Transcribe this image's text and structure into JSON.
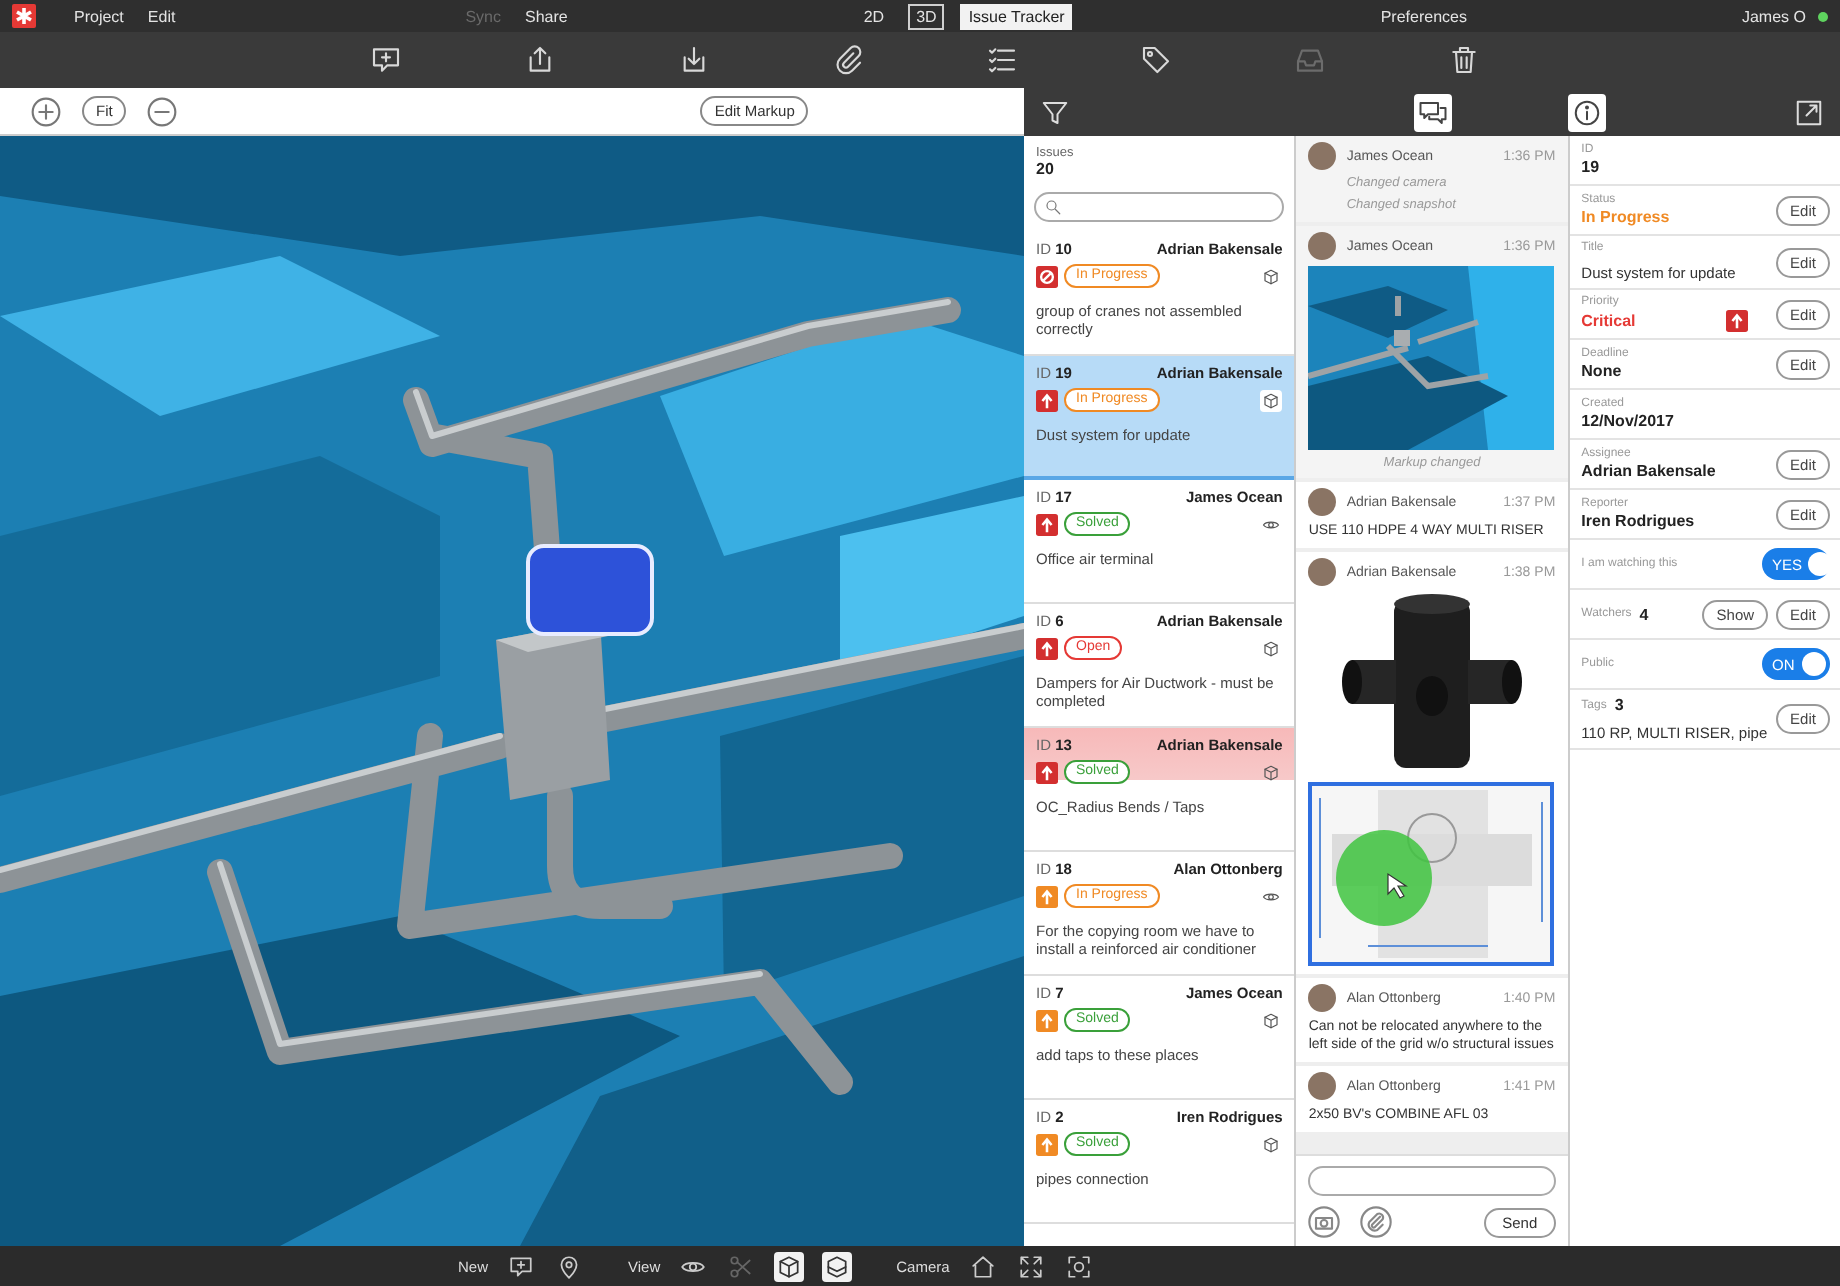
{
  "menu": {
    "items": [
      {
        "label": "Project",
        "disabled": false
      },
      {
        "label": "Edit",
        "disabled": false
      },
      {
        "label": "Sync",
        "disabled": true
      },
      {
        "label": "Share",
        "disabled": false
      }
    ],
    "modes": [
      {
        "label": "2D",
        "kind": "view",
        "selected": false
      },
      {
        "label": "3D",
        "kind": "view",
        "selected": true
      },
      {
        "label": "Issue Tracker",
        "kind": "panel",
        "selected": true
      }
    ],
    "preferences": "Preferences",
    "user": {
      "name": "James O",
      "online": true
    }
  },
  "toolbar": [
    {
      "kind": "comment",
      "disabled": false
    },
    {
      "kind": "upload",
      "disabled": false
    },
    {
      "kind": "download",
      "disabled": false
    },
    {
      "kind": "paperclip",
      "disabled": false
    },
    {
      "kind": "checklist",
      "disabled": false
    },
    {
      "kind": "tag",
      "disabled": false
    },
    {
      "kind": "inbox",
      "disabled": true
    },
    {
      "kind": "trash",
      "disabled": false
    }
  ],
  "viewer": {
    "fit": "Fit",
    "edit_markup": "Edit Markup"
  },
  "panel_tabs": [
    {
      "kind": "filter",
      "selected": false
    },
    {
      "kind": "comments",
      "selected": true
    },
    {
      "kind": "info",
      "selected": true
    },
    {
      "kind": "detach",
      "selected": false
    }
  ],
  "issues": {
    "label": "Issues",
    "count": "20",
    "items": [
      {
        "id_label": "ID",
        "id": "10",
        "author": "Adrian Bakensale",
        "priority": {
          "color": "#d32f2f",
          "blocked": true
        },
        "status": "In Progress",
        "color": "#f08a24",
        "kind": "cube",
        "description": "group of cranes not assembled correctly",
        "selected": false,
        "highlighted": false
      },
      {
        "id_label": "ID",
        "id": "19",
        "author": "Adrian Bakensale",
        "priority": {
          "color": "#d32f2f",
          "blocked": false
        },
        "status": "In Progress",
        "color": "#f08a24",
        "kind": "cube",
        "description": "Dust system for update",
        "selected": true,
        "highlighted": false
      },
      {
        "id_label": "ID",
        "id": "17",
        "author": "James Ocean",
        "priority": {
          "color": "#d32f2f",
          "blocked": false
        },
        "status": "Solved",
        "color": "#3aa03a",
        "kind": "eye",
        "description": "Office air terminal",
        "selected": false,
        "highlighted": false
      },
      {
        "id_label": "ID",
        "id": "6",
        "author": "Adrian Bakensale",
        "priority": {
          "color": "#d32f2f",
          "blocked": false
        },
        "status": "Open",
        "color": "#e53935",
        "kind": "cube",
        "description": "Dampers for Air Ductwork - must be completed",
        "selected": false,
        "highlighted": false
      },
      {
        "id_label": "ID",
        "id": "13",
        "author": "Adrian Bakensale",
        "priority": {
          "color": "#d32f2f",
          "blocked": false
        },
        "status": "Solved",
        "color": "#3aa03a",
        "kind": "cube",
        "description": "OC_Radius Bends / Taps",
        "selected": false,
        "highlighted": true
      },
      {
        "id_label": "ID",
        "id": "18",
        "author": "Alan Ottonberg",
        "priority": {
          "color": "#f08a24",
          "blocked": false
        },
        "status": "In Progress",
        "color": "#f08a24",
        "kind": "eye",
        "description": "For the copying room we have to install a reinforced air conditioner",
        "selected": false,
        "highlighted": false
      },
      {
        "id_label": "ID",
        "id": "7",
        "author": "James Ocean",
        "priority": {
          "color": "#f08a24",
          "blocked": false
        },
        "status": "Solved",
        "color": "#3aa03a",
        "kind": "cube",
        "description": "add taps to these places",
        "selected": false,
        "highlighted": false
      },
      {
        "id_label": "ID",
        "id": "2",
        "author": "Iren Rodrigues",
        "priority": {
          "color": "#f08a24",
          "blocked": false
        },
        "status": "Solved",
        "color": "#3aa03a",
        "kind": "cube",
        "description": "pipes connection",
        "selected": false,
        "highlighted": false
      }
    ]
  },
  "comments": {
    "items": [
      {
        "kind": "event",
        "author": "James Ocean",
        "time": "1:36 PM",
        "lines": [
          "Changed camera",
          "Changed snapshot"
        ]
      },
      {
        "kind": "snapshot",
        "author": "James Ocean",
        "time": "1:36 PM",
        "caption": "Markup changed"
      },
      {
        "kind": "text",
        "author": "Adrian Bakensale",
        "time": "1:37 PM",
        "text": "USE 110 HDPE 4 WAY MULTI RISER"
      },
      {
        "kind": "images",
        "author": "Adrian Bakensale",
        "time": "1:38 PM"
      },
      {
        "kind": "text",
        "author": "Alan Ottonberg",
        "time": "1:40 PM",
        "text": "Can not be relocated anywhere to the left side of the grid w/o structural issues"
      },
      {
        "kind": "text",
        "author": "Alan Ottonberg",
        "time": "1:41 PM",
        "text": "2x50 BV's COMBINE AFL 03"
      }
    ],
    "send": "Send"
  },
  "details": [
    {
      "kind": "text",
      "label": "ID",
      "value": "19"
    },
    {
      "kind": "text",
      "label": "Status",
      "value": "In Progress",
      "color": "#f08a24",
      "action": "Edit"
    },
    {
      "kind": "title",
      "label": "Title",
      "value": "Dust system for update",
      "action": "Edit"
    },
    {
      "kind": "priority",
      "label": "Priority",
      "value": "Critical",
      "color": "#e53935",
      "priority": {
        "color": "#d32f2f",
        "blocked": false
      },
      "action": "Edit"
    },
    {
      "kind": "text",
      "label": "Deadline",
      "value": "None",
      "action": "Edit"
    },
    {
      "kind": "text",
      "label": "Created",
      "value": "12/Nov/2017"
    },
    {
      "kind": "text",
      "label": "Assignee",
      "value": "Adrian Bakensale",
      "action": "Edit"
    },
    {
      "kind": "text",
      "label": "Reporter",
      "value": "Iren Rodrigues",
      "action": "Edit"
    },
    {
      "kind": "toggle",
      "label": "I am watching this",
      "value": "YES",
      "on": true
    },
    {
      "kind": "count",
      "label": "Watchers",
      "count": "4",
      "secondary": "Show",
      "action": "Edit"
    },
    {
      "kind": "toggle",
      "label": "Public",
      "value": "ON",
      "on": true
    },
    {
      "kind": "tags",
      "label": "Tags",
      "count": "3",
      "action": "Edit",
      "value": "110 RP, MULTI RISER, pipe"
    }
  ],
  "bottom_bar": {
    "groups": [
      {
        "label": "New",
        "tools": [
          {
            "kind": "comment",
            "selected": false,
            "disabled": false
          },
          {
            "kind": "pin",
            "selected": false,
            "disabled": false
          }
        ]
      },
      {
        "label": "View",
        "tools": [
          {
            "kind": "eye",
            "selected": false,
            "disabled": false
          },
          {
            "kind": "scissors",
            "selected": false,
            "disabled": true
          },
          {
            "kind": "cube",
            "selected": true,
            "disabled": false
          },
          {
            "kind": "section",
            "selected": true,
            "disabled": false
          }
        ]
      },
      {
        "label": "Camera",
        "tools": [
          {
            "kind": "home",
            "selected": false,
            "disabled": false
          },
          {
            "kind": "fullscreen",
            "selected": false,
            "disabled": false
          },
          {
            "kind": "focus",
            "selected": false,
            "disabled": false
          }
        ]
      }
    ]
  }
}
